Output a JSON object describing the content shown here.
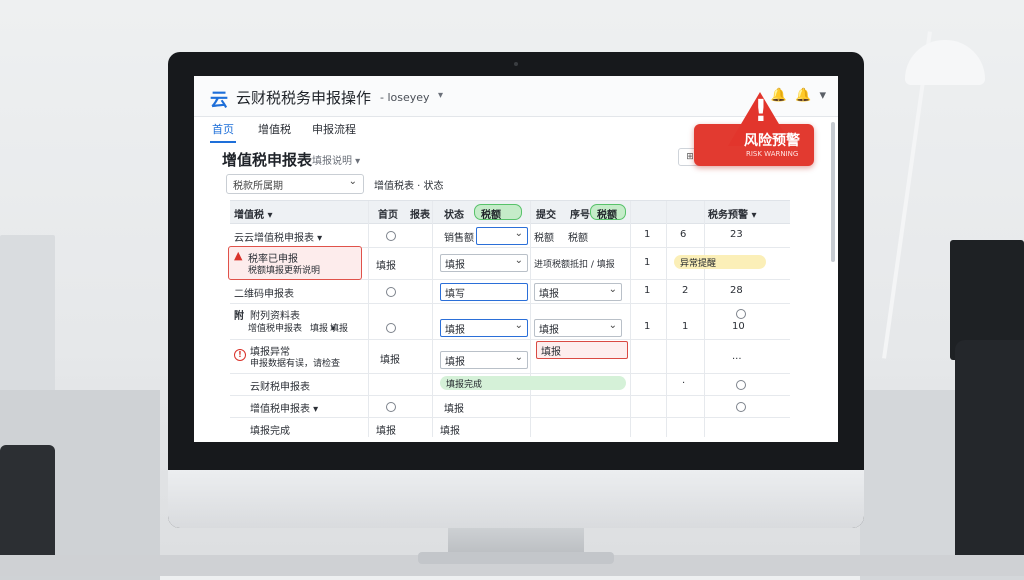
{
  "app": {
    "logo": "云",
    "title": "云财税税务申报操作",
    "user_name": "- loseyey",
    "user_chevron": "▾",
    "bell_icon": "🔔",
    "alert_icon": "🔔",
    "chevron_icon": "▾"
  },
  "tabs": [
    {
      "label": "首页",
      "active": true
    },
    {
      "label": "增值税",
      "active": false
    },
    {
      "label": "申报流程",
      "active": false
    }
  ],
  "page": {
    "title": "增值税申报表",
    "subtitle": "填报说明 ▾",
    "corner_button": "⊞"
  },
  "filters": {
    "period_value": "税款所属期",
    "period_chevron": "⌄",
    "label": "增值税表 · 状态"
  },
  "table": {
    "headers": [
      "增值税 ▾",
      "首页",
      "报表",
      "状态",
      "税额",
      "提交",
      "序号",
      "税额",
      "税务预警 ▾"
    ],
    "rows": [
      {
        "name": "云云增值税申报表 ▾",
        "c3": "销售额",
        "c5": "税额",
        "c6": "税额",
        "n1": "1",
        "n2": "6",
        "n3": "23"
      },
      {
        "name": "税率已申报",
        "name2": "税额填报更新说明",
        "c2": "填报",
        "c3": "填报",
        "c5": "进项税额抵扣 / 填报",
        "n1": "1",
        "pill": "异常提醒"
      },
      {
        "name": "二维码申报表",
        "c3": "填写",
        "c5": "填报",
        "n1": "1",
        "n2": "2",
        "n3": "28"
      },
      {
        "name": "附",
        "name2": "附列资料表"
      },
      {
        "name": "增值税申报表",
        "name2": "填报 ▾",
        "name3": "填报",
        "c3": "填报",
        "c5": "填报",
        "n1": "1",
        "n2": "1",
        "n3": "10"
      },
      {
        "name": "填报异常",
        "name2": "申报数据有误，请检查",
        "c2": "填报",
        "c3": "填报",
        "c5": "填报",
        "n3": "..."
      },
      {
        "name": "云财税申报表",
        "pill": "填报完成"
      },
      {
        "name": "增值税申报表 ▾",
        "c3": "填报"
      },
      {
        "name": "填报完成",
        "c2": "填报",
        "c3": "填报"
      }
    ]
  },
  "risk_alert": {
    "label": "风险预警",
    "sub": "RISK WARNING",
    "icon": "!"
  }
}
